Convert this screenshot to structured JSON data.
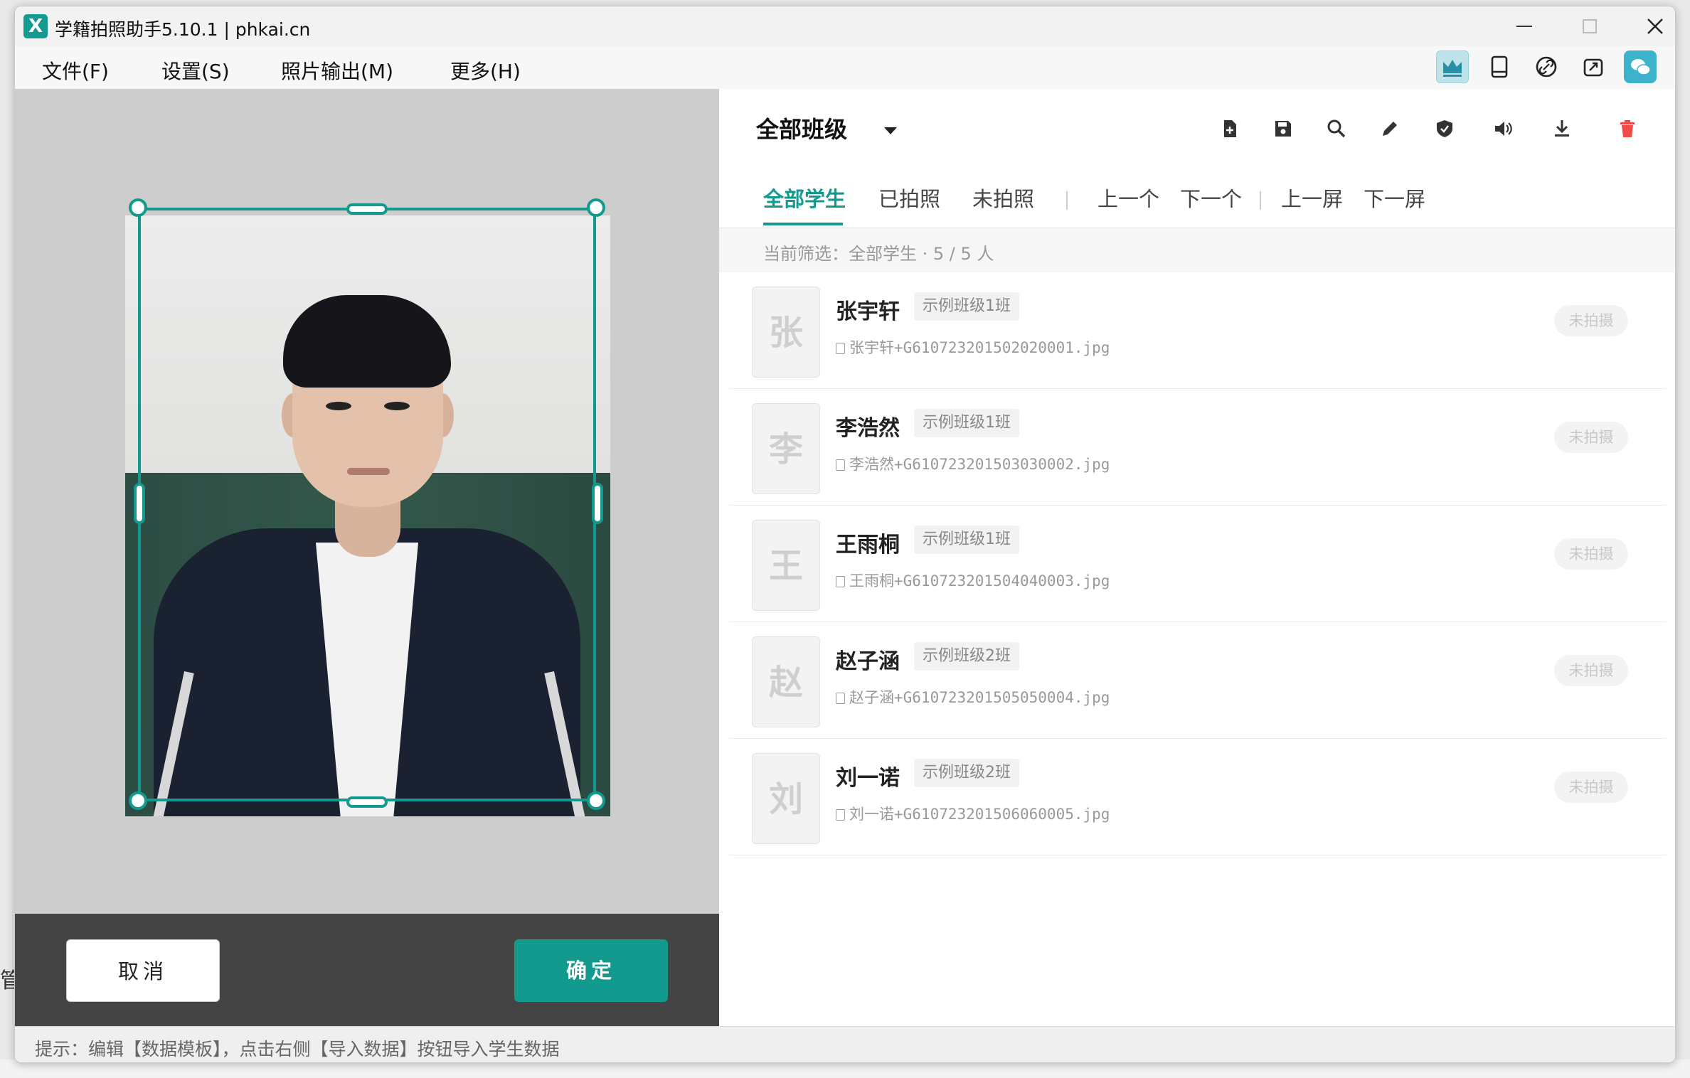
{
  "window": {
    "title": "学籍拍照助手5.10.1 | phkai.cn",
    "logo_text": "X"
  },
  "menu": [
    "文件(F)",
    "设置(S)",
    "照片输出(M)",
    "更多(H)"
  ],
  "top_icons": [
    "crown-icon",
    "tablet-icon",
    "link-icon",
    "share-icon",
    "wechat-icon"
  ],
  "editor": {
    "cancel_label": "取消",
    "confirm_label": "确定"
  },
  "class_filter": {
    "selected": "全部班级"
  },
  "toolbar_icons": [
    "add-file-icon",
    "save-icon",
    "search-icon",
    "edit-icon",
    "shield-icon",
    "volume-icon",
    "download-icon",
    "delete-icon"
  ],
  "tabs": [
    {
      "label": "全部学生",
      "active": true
    },
    {
      "label": "已拍照",
      "active": false
    },
    {
      "label": "未拍照",
      "active": false
    }
  ],
  "nav": [
    "上一个",
    "下一个",
    "上一屏",
    "下一屏"
  ],
  "filter_summary": "当前筛选：全部学生 · 5 / 5 人",
  "students": [
    {
      "initial": "张",
      "name": "张宇轩",
      "class": "示例班级1班",
      "file": "张宇轩+G610723201502020001.jpg",
      "status": "未拍摄"
    },
    {
      "initial": "李",
      "name": "李浩然",
      "class": "示例班级1班",
      "file": "李浩然+G610723201503030002.jpg",
      "status": "未拍摄"
    },
    {
      "initial": "王",
      "name": "王雨桐",
      "class": "示例班级1班",
      "file": "王雨桐+G610723201504040003.jpg",
      "status": "未拍摄"
    },
    {
      "initial": "赵",
      "name": "赵子涵",
      "class": "示例班级2班",
      "file": "赵子涵+G610723201505050004.jpg",
      "status": "未拍摄"
    },
    {
      "initial": "刘",
      "name": "刘一诺",
      "class": "示例班级2班",
      "file": "刘一诺+G610723201506060005.jpg",
      "status": "未拍摄"
    }
  ],
  "status_bar": "提示：编辑【数据模板】，点击右侧【导入数据】按钮导入学生数据",
  "colors": {
    "accent": "#139a8f",
    "danger": "#f04a4a"
  }
}
